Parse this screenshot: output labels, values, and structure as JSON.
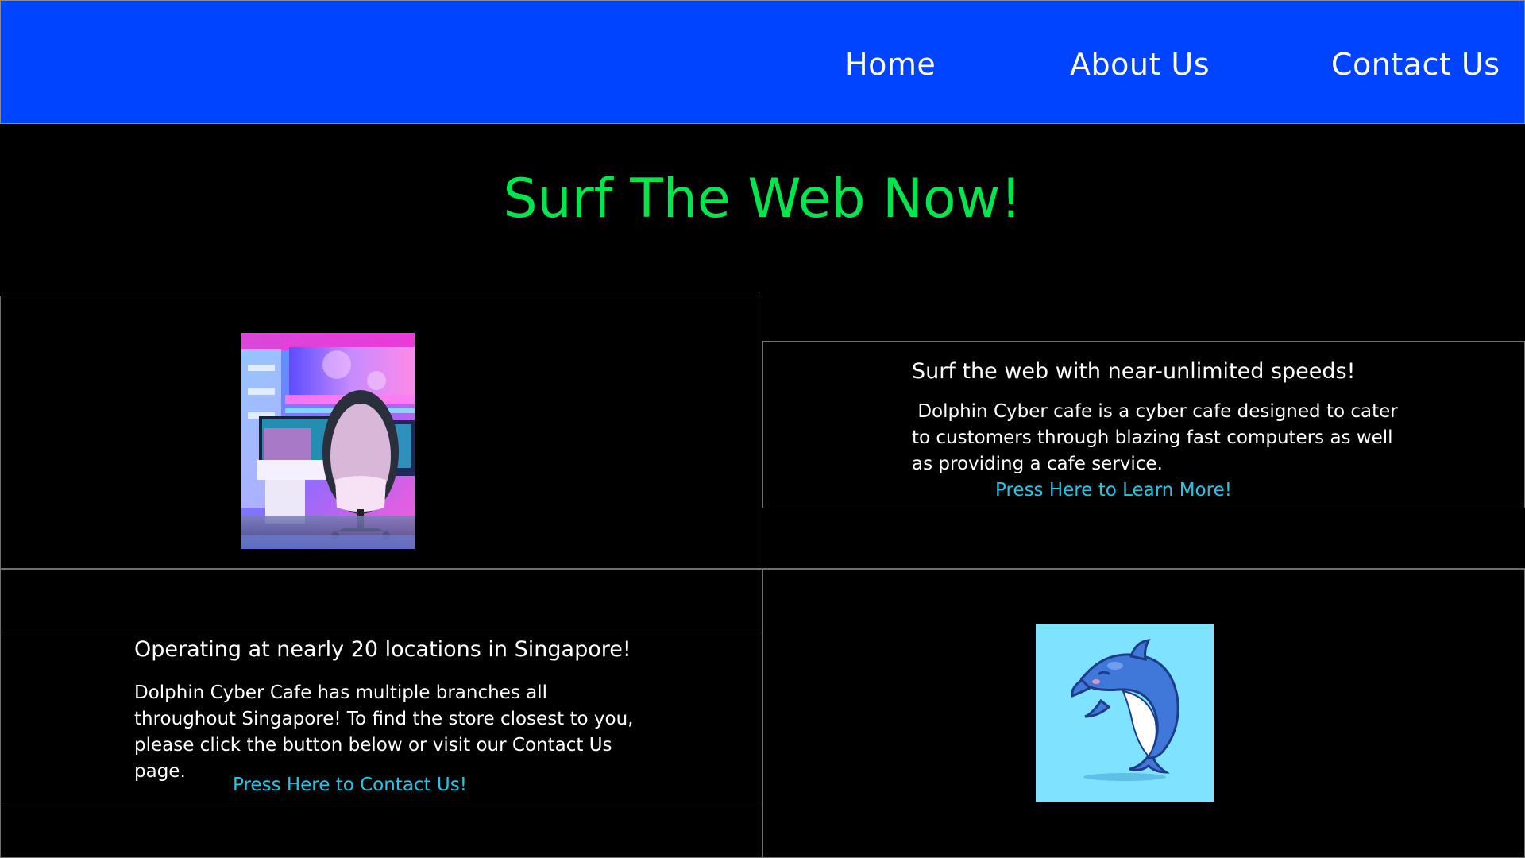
{
  "colors": {
    "header_bg": "#0044ff",
    "page_bg": "#000000",
    "hero_title": "#00e64d",
    "link_cyan": "#1fc8e8",
    "text": "#ffffff"
  },
  "nav": {
    "items": [
      {
        "label": "Home"
      },
      {
        "label": "About Us"
      },
      {
        "label": "Contact Us"
      }
    ]
  },
  "hero": {
    "title": "Surf The Web Now!"
  },
  "section_speed": {
    "heading": "Surf the web with near-unlimited speeds!",
    "body": " Dolphin Cyber cafe is a cyber cafe designed to cater to customers through blazing fast computers as well as providing a cafe service.",
    "link_label": "Press Here to Learn More!",
    "image_icon": "gaming-room-image"
  },
  "section_locations": {
    "heading": "Operating at nearly 20 locations in Singapore!",
    "body": "Dolphin Cyber Cafe has multiple branches all throughout Singapore! To find the store closest to you, please click the button below or visit our Contact Us page.",
    "link_label": "Press Here to Contact Us!",
    "image_icon": "dolphin-image"
  }
}
